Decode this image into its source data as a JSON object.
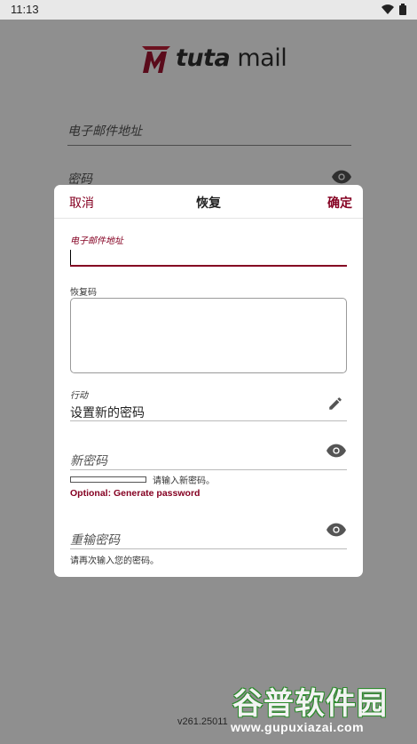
{
  "status_bar": {
    "time": "11:13",
    "icons": [
      "wifi-icon",
      "battery-icon"
    ]
  },
  "brand": {
    "name_bold": "tuta",
    "name_rest": "mail",
    "logo_mark_color": "#a01530",
    "accent": "#850122"
  },
  "login_form": {
    "email_placeholder": "电子邮件地址",
    "password_placeholder": "密码"
  },
  "version": "v261.25011",
  "dialog": {
    "cancel_label": "取消",
    "title": "恢复",
    "confirm_label": "确定",
    "email_label": "电子邮件地址",
    "email_value": "",
    "recovery_code_label": "恢复码",
    "action_label": "行动",
    "action_value": "设置新的密码",
    "new_password_placeholder": "新密码",
    "strength_hint": "请输入新密码。",
    "generate_password_link": "Optional: Generate password",
    "repeat_password_placeholder": "重输密码",
    "repeat_password_hint": "请再次输入您的密码。"
  },
  "watermark": {
    "title": "谷普软件园",
    "url": "www.gupuxiazai.com"
  }
}
